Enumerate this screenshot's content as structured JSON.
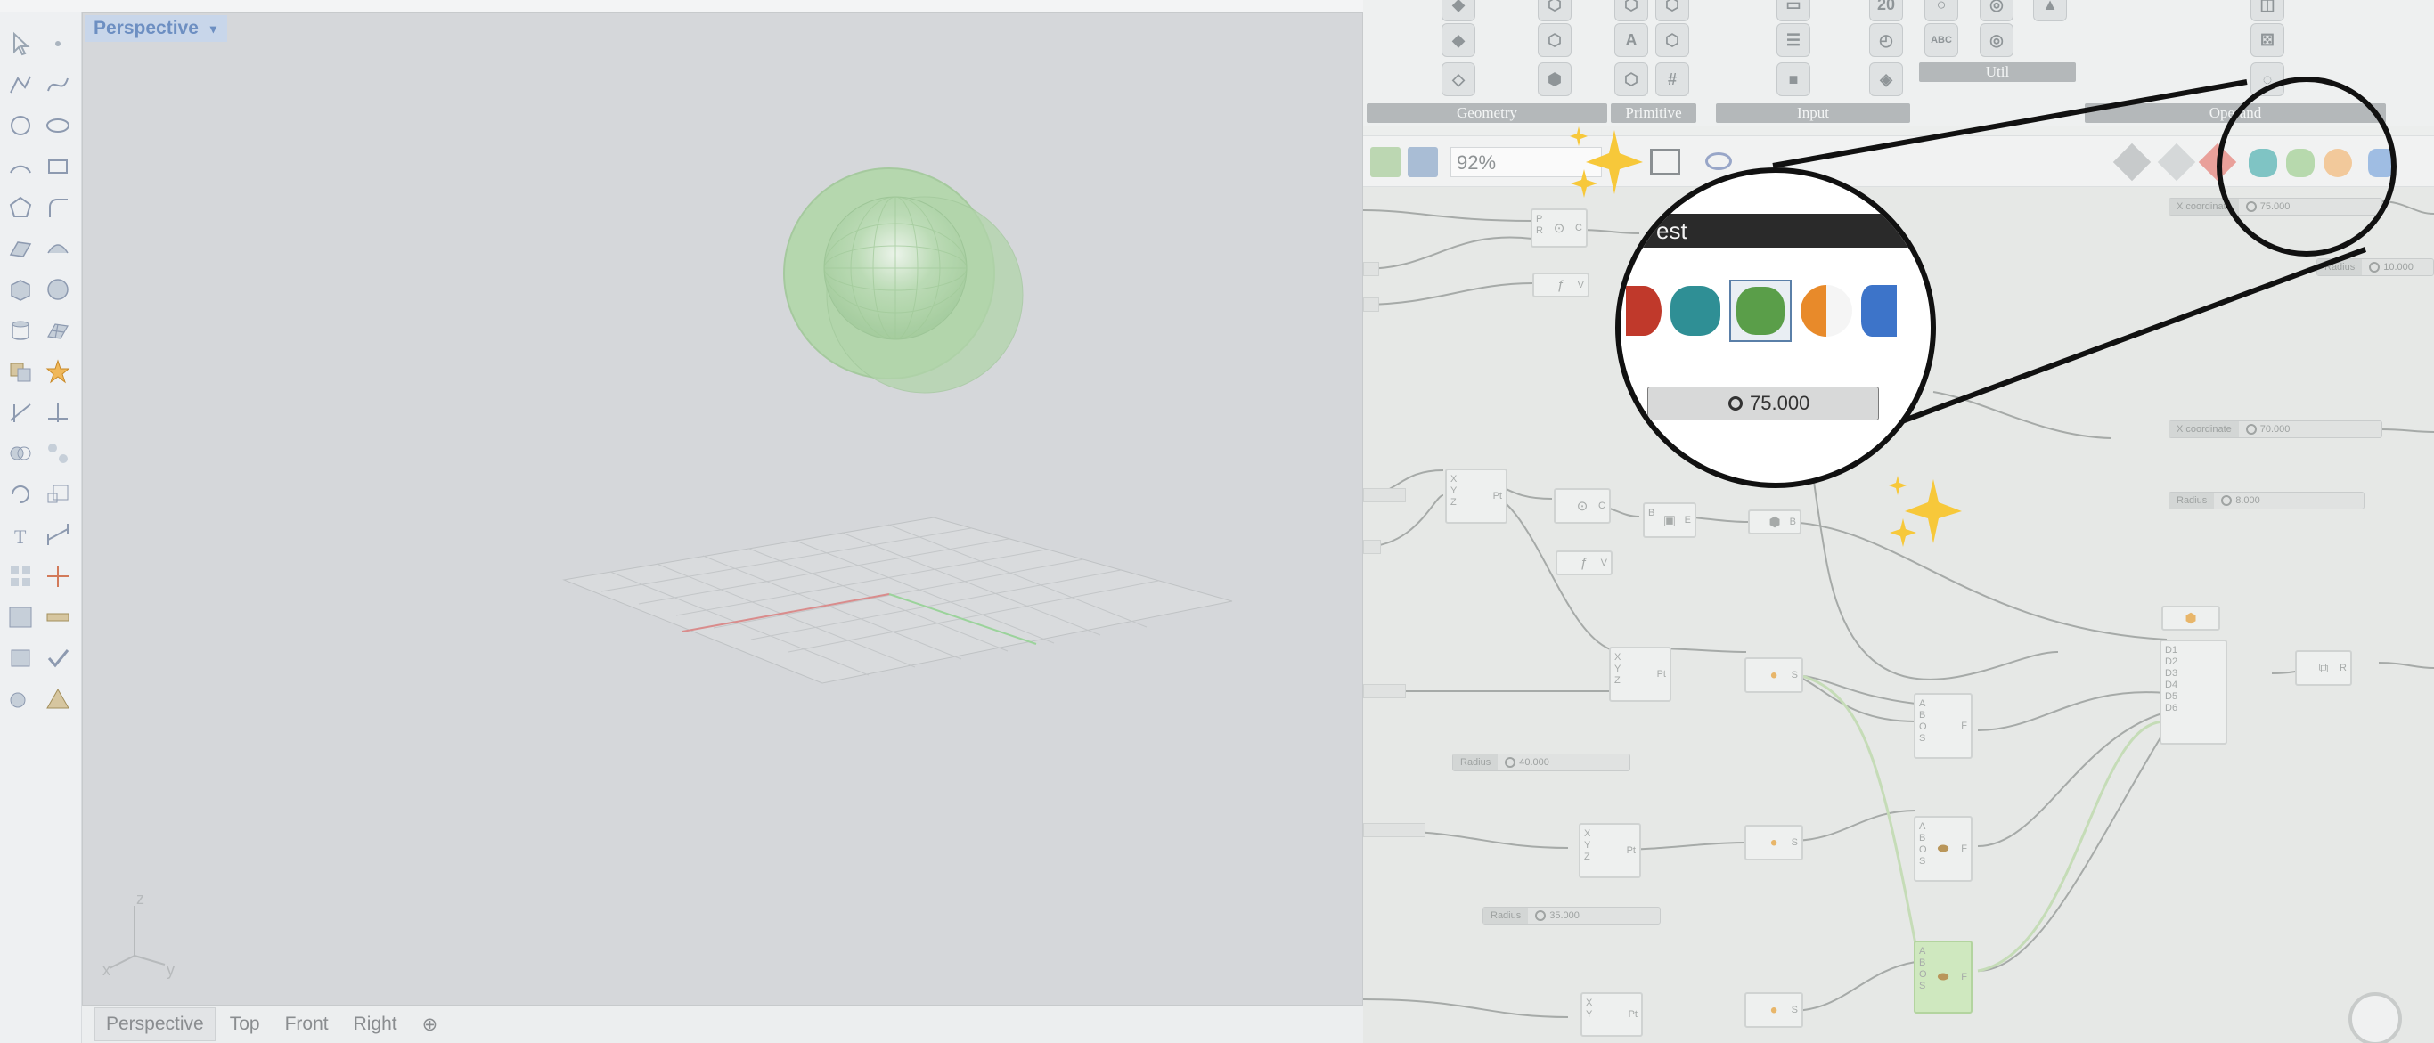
{
  "viewport": {
    "name": "Perspective",
    "tabs": [
      "Perspective",
      "Top",
      "Front",
      "Right"
    ],
    "axes": {
      "x": "x",
      "y": "y",
      "z": "z"
    }
  },
  "grasshopper": {
    "ribbon_groups": [
      "Geometry",
      "Primitive",
      "Input",
      "Util",
      "Operand"
    ],
    "ribbon_icon_text": {
      "twenty": "20",
      "abc": "ABC"
    },
    "zoom": "92%",
    "sliders": [
      {
        "label": "X coordinate",
        "value": "75.000"
      },
      {
        "label": "Radius",
        "value": "10.000"
      },
      {
        "label": "X coordinate",
        "value": "70.000"
      },
      {
        "label": "Radius",
        "value": "8.000"
      },
      {
        "label": "Radius",
        "value": "40.000"
      },
      {
        "label": "Radius",
        "value": "35.000"
      }
    ],
    "node_port_labels": {
      "pt": "Pt",
      "xyz": [
        "X",
        "Y",
        "Z"
      ],
      "s_ports": [
        "P",
        "R"
      ],
      "s": "S",
      "bool": [
        "A",
        "B",
        "O",
        "S"
      ],
      "f": "F",
      "merge": [
        "D1",
        "D2",
        "D3",
        "D4",
        "D5",
        "D6"
      ],
      "r": "R",
      "c": "C",
      "b": "B",
      "e": "E",
      "v": "V"
    }
  },
  "magnifier": {
    "title": "est",
    "slider_value": "75.000"
  },
  "colors": {
    "sphere": "#a9d3a1",
    "accent_viewport": "#6d8fc2",
    "sparkle": "#f2c12e"
  }
}
